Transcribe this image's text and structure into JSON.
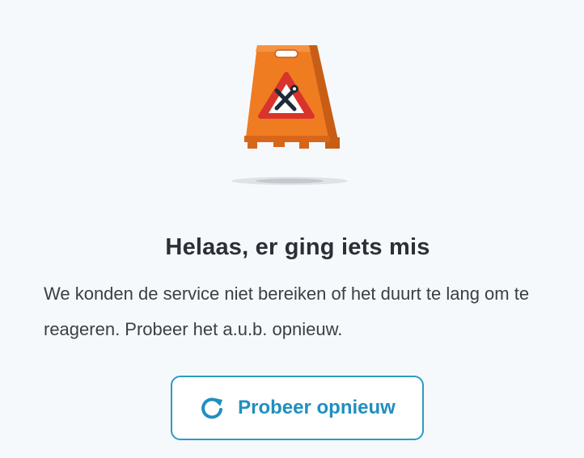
{
  "error": {
    "title": "Helaas, er ging iets mis",
    "message": "We konden de service niet bereiken of het duurt te lang om te reageren. Probeer het a.u.b. opnieuw."
  },
  "retry": {
    "label": "Probeer opnieuw",
    "icon": "refresh-icon"
  },
  "illustration": {
    "icon": "construction-sign-icon"
  },
  "colors": {
    "background": "#f6f9fc",
    "accent": "#1f8fbf",
    "sign_orange": "#f07c22",
    "warning_red": "#d8342b"
  }
}
